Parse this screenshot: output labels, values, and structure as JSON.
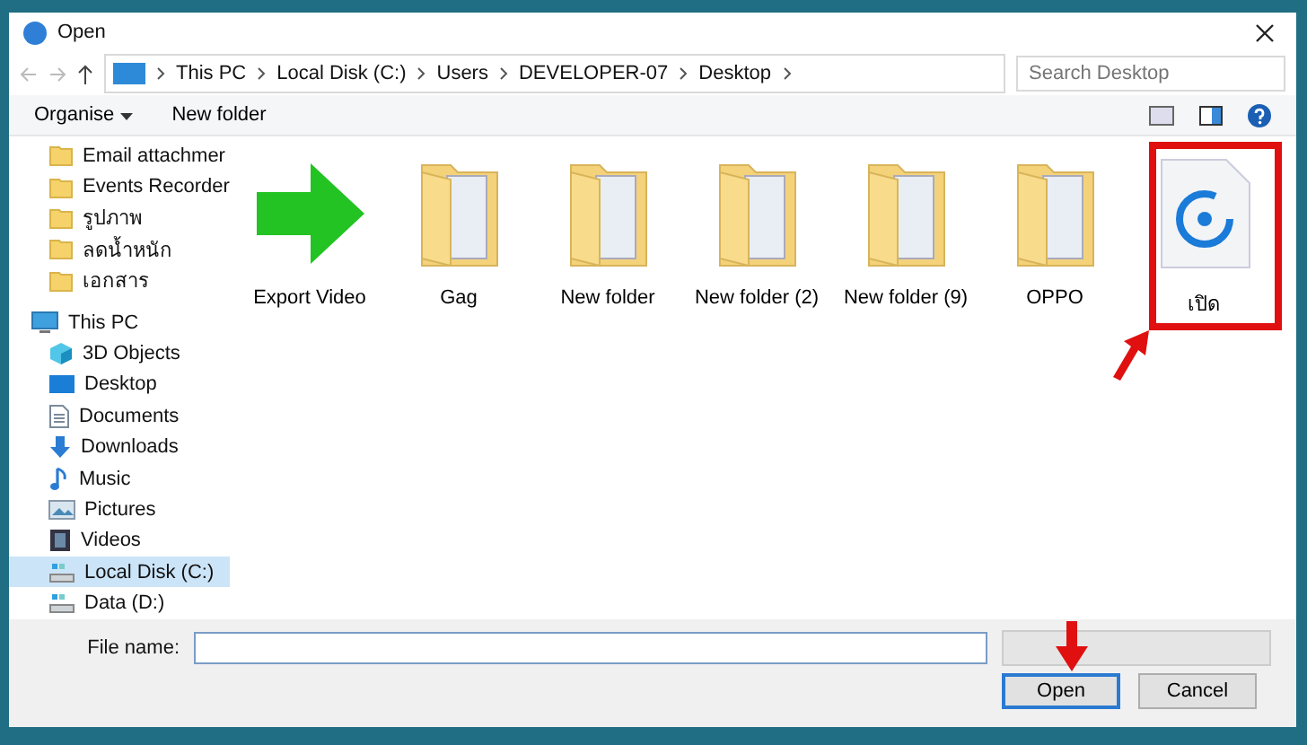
{
  "window": {
    "title": "Open"
  },
  "address": {
    "segments": [
      "This PC",
      "Local Disk (C:)",
      "Users",
      "DEVELOPER-07",
      "Desktop"
    ]
  },
  "search": {
    "placeholder": "Search Desktop"
  },
  "toolbar": {
    "organise": "Organise",
    "new_folder": "New folder"
  },
  "sidebar": {
    "items": [
      {
        "label": "Email attachmer",
        "kind": "folder",
        "selected": false
      },
      {
        "label": "Events Recorder",
        "kind": "folder",
        "selected": false
      },
      {
        "label": "รูปภาพ",
        "kind": "folder",
        "selected": false
      },
      {
        "label": "ลดน้ำหนัก",
        "kind": "folder",
        "selected": false
      },
      {
        "label": "เอกสาร",
        "kind": "folder",
        "selected": false
      },
      {
        "label": "This PC",
        "kind": "pc",
        "selected": false,
        "children": [
          {
            "label": "3D Objects",
            "kind": "objects",
            "selected": false
          },
          {
            "label": "Desktop",
            "kind": "desktop",
            "selected": false
          },
          {
            "label": "Documents",
            "kind": "documents",
            "selected": false
          },
          {
            "label": "Downloads",
            "kind": "downloads",
            "selected": false
          },
          {
            "label": "Music",
            "kind": "music",
            "selected": false
          },
          {
            "label": "Pictures",
            "kind": "pictures",
            "selected": false
          },
          {
            "label": "Videos",
            "kind": "videos",
            "selected": false
          },
          {
            "label": "Local Disk (C:)",
            "kind": "disk",
            "selected": true
          },
          {
            "label": "Data (D:)",
            "kind": "disk",
            "selected": false
          }
        ]
      }
    ]
  },
  "files": [
    {
      "label": "Export Video",
      "kind": "arrow"
    },
    {
      "label": "Gag",
      "kind": "folder"
    },
    {
      "label": "New folder",
      "kind": "folder"
    },
    {
      "label": "New folder (2)",
      "kind": "folder"
    },
    {
      "label": "New folder (9)",
      "kind": "folder"
    },
    {
      "label": "OPPO",
      "kind": "folder"
    },
    {
      "label": "เปิด",
      "kind": "app-file"
    }
  ],
  "footer": {
    "file_name_label": "File name:",
    "buttons": [
      {
        "label": "Open",
        "default": true
      },
      {
        "label": "Cancel",
        "default": false
      }
    ]
  }
}
